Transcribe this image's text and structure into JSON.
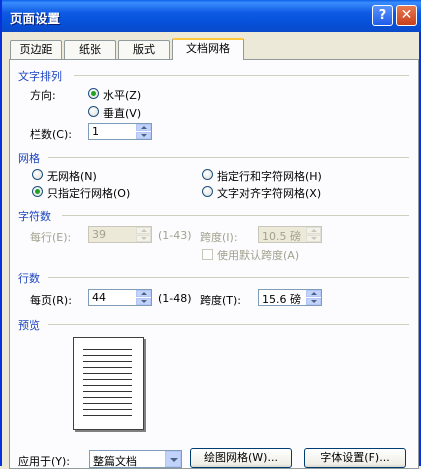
{
  "window": {
    "title": "页面设置",
    "help_label": "?",
    "close_label": "✕"
  },
  "tabs": [
    {
      "label": "页边距",
      "active": false
    },
    {
      "label": "纸张",
      "active": false
    },
    {
      "label": "版式",
      "active": false
    },
    {
      "label": "文档网格",
      "active": true
    }
  ],
  "text_direction": {
    "section_title": "文字排列",
    "direction_label": "方向:",
    "horizontal_label": "水平(Z)",
    "vertical_label": "垂直(V)",
    "selected": "horizontal",
    "columns_label": "栏数(C):",
    "columns_value": "1"
  },
  "grid": {
    "section_title": "网格",
    "options": [
      {
        "label": "无网格(N)",
        "selected": false
      },
      {
        "label": "指定行和字符网格(H)",
        "selected": false
      },
      {
        "label": "只指定行网格(O)",
        "selected": true
      },
      {
        "label": "文字对齐字符网格(X)",
        "selected": false
      }
    ]
  },
  "chars": {
    "section_title": "字符数",
    "per_line_label": "每行(E):",
    "per_line_value": "39",
    "per_line_range": "(1-43)",
    "pitch_label": "跨度(I):",
    "pitch_value": "10.5 磅",
    "default_pitch_label": "使用默认跨度(A)"
  },
  "lines": {
    "section_title": "行数",
    "per_page_label": "每页(R):",
    "per_page_value": "44",
    "per_page_range": "(1-48)",
    "pitch_label": "跨度(T):",
    "pitch_value": "15.6 磅"
  },
  "preview": {
    "section_title": "预览"
  },
  "bottom": {
    "apply_label": "应用于(Y):",
    "apply_value": "整篇文档",
    "draw_grid_button": "绘图网格(W)...",
    "font_settings_button": "字体设置(F)..."
  },
  "colors": {
    "section_title": "#1C44C0",
    "title_bar": "#0A5FE8",
    "radio_selected": "#21A121"
  }
}
